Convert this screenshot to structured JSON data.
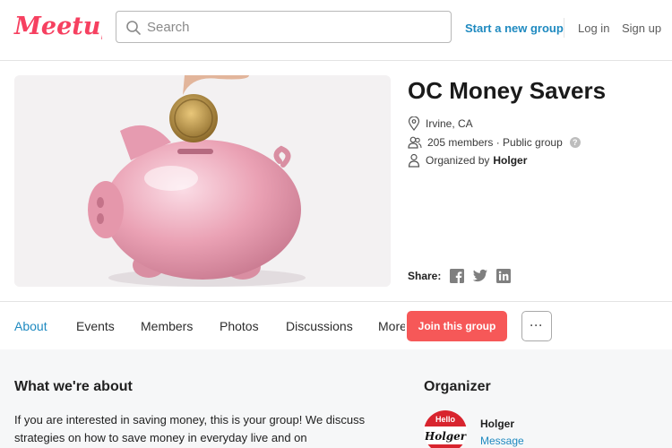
{
  "header": {
    "logo_text": "Meetup",
    "search_placeholder": "Search",
    "start_group": "Start a new group",
    "login": "Log in",
    "signup": "Sign up"
  },
  "group": {
    "name": "OC Money Savers",
    "location": "Irvine, CA",
    "members": "205 members · Public group",
    "organized_by_label": "Organized by",
    "organizer": "Holger",
    "share_label": "Share:",
    "share_icons": [
      "facebook-icon",
      "twitter-icon",
      "linkedin-icon"
    ]
  },
  "tabs": [
    {
      "label": "About",
      "active": true
    },
    {
      "label": "Events",
      "active": false
    },
    {
      "label": "Members",
      "active": false
    },
    {
      "label": "Photos",
      "active": false
    },
    {
      "label": "Discussions",
      "active": false
    },
    {
      "label": "More",
      "active": false
    }
  ],
  "actions": {
    "join": "Join this group",
    "more": "···"
  },
  "about": {
    "heading": "What we're about",
    "text": "If you are interested in saving money, this is your group! We discuss strategies on how to save money in everyday live and on"
  },
  "organizer_panel": {
    "heading": "Organizer",
    "name": "Holger",
    "message": "Message",
    "badge_hello": "Hello",
    "badge_name": "Holger"
  },
  "colors": {
    "brand": "#f64060",
    "link": "#1f8ac0",
    "join": "#f65858"
  }
}
